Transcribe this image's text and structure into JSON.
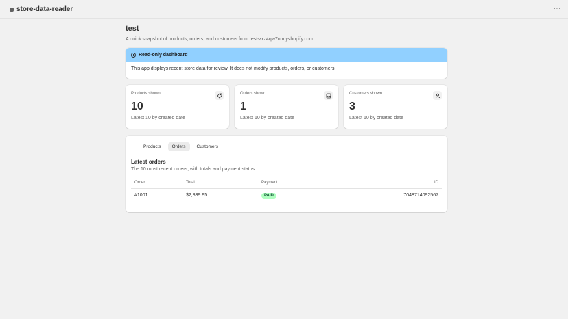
{
  "app": {
    "title": "store-data-reader",
    "more_label": "···"
  },
  "page": {
    "title": "test",
    "subtitle": "A quick snapshot of products, orders, and customers from test-zxz4qw7n.myshopify.com."
  },
  "banner": {
    "title": "Read-only dashboard",
    "body": "This app displays recent store data for review. It does not modify products, orders, or customers.",
    "color": "#91d0ff"
  },
  "stats": [
    {
      "label": "Products shown",
      "value": "10",
      "note": "Latest 10 by created date",
      "icon": "tag-icon"
    },
    {
      "label": "Orders shown",
      "value": "1",
      "note": "Latest 10 by created date",
      "icon": "inbox-icon"
    },
    {
      "label": "Customers shown",
      "value": "3",
      "note": "Latest 10 by created date",
      "icon": "person-icon"
    }
  ],
  "tabs": [
    {
      "label": "Products",
      "active": false
    },
    {
      "label": "Orders",
      "active": true
    },
    {
      "label": "Customers",
      "active": false
    }
  ],
  "orders": {
    "title": "Latest orders",
    "subtitle": "The 10 most recent orders, with totals and payment status.",
    "columns": [
      "Order",
      "Total",
      "Payment",
      "ID"
    ],
    "rows": [
      {
        "order": "#1001",
        "total": "$2,839.95",
        "payment": "PAID",
        "id": "7048714092567"
      }
    ]
  }
}
